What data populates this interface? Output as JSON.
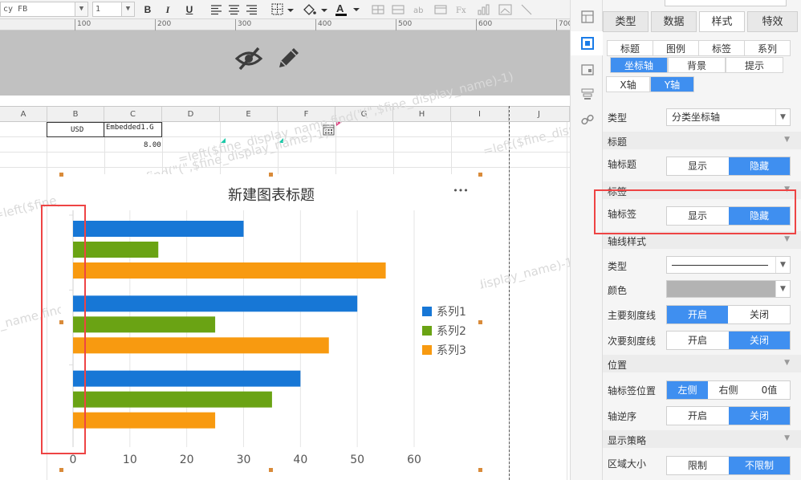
{
  "toolbar": {
    "font_name": "cy FB",
    "font_size": "1",
    "bold": "B",
    "italic": "I",
    "underline": "U"
  },
  "ruler": {
    "labels": [
      "100",
      "200",
      "300",
      "400",
      "500",
      "600",
      "700"
    ]
  },
  "columns": [
    "A",
    "B",
    "C",
    "D",
    "E",
    "F",
    "G",
    "H",
    "I",
    "J"
  ],
  "cells": {
    "b1": "USD",
    "c1": "Embedded1.G",
    "c2": "8.00"
  },
  "watermark": {
    "formula": "=left($fine_display_name,find(\"(\",$fine_display_name)-1)"
  },
  "chart_data": {
    "type": "bar",
    "orientation": "horizontal",
    "title": "新建图表标题",
    "menu": "•••",
    "categories": [
      "",
      "",
      ""
    ],
    "series": [
      {
        "name": "系列1",
        "color": "#1777d6",
        "values": [
          30,
          50,
          40
        ]
      },
      {
        "name": "系列2",
        "color": "#6aa314",
        "values": [
          15,
          25,
          35
        ]
      },
      {
        "name": "系列3",
        "color": "#f89a10",
        "values": [
          55,
          45,
          25
        ]
      }
    ],
    "xlim": [
      0,
      60
    ],
    "xticks": [
      "0",
      "10",
      "20",
      "30",
      "40",
      "50",
      "60"
    ],
    "grid": true,
    "legend": "right",
    "xlabel": "",
    "ylabel": ""
  },
  "panel": {
    "tabs": [
      "类型",
      "数据",
      "样式",
      "特效"
    ],
    "active_tab": 2,
    "subtabs_row1": [
      "标题",
      "图例",
      "标签",
      "系列"
    ],
    "subtabs_row2": [
      "坐标轴",
      "背景",
      "提示"
    ],
    "active_subtab": "坐标轴",
    "axis_tabs": [
      "X轴",
      "Y轴"
    ],
    "active_axis": "Y轴",
    "type_label": "类型",
    "type_value": "分类坐标轴",
    "section_title": "标题",
    "axis_title_label": "轴标题",
    "show": "显示",
    "hide": "隐藏",
    "section_label": "标签",
    "axis_label_label": "轴标签",
    "section_line": "轴线样式",
    "line_type_label": "类型",
    "color_label": "颜色",
    "color_value": "#b3b3b3",
    "major_tick_label": "主要刻度线",
    "minor_tick_label": "次要刻度线",
    "on": "开启",
    "off": "关闭",
    "section_position": "位置",
    "label_pos_label": "轴标签位置",
    "pos_left": "左侧",
    "pos_right": "右侧",
    "pos_zero": "0值",
    "reverse_label": "轴逆序",
    "section_display": "显示策略",
    "area_label": "区域大小",
    "limit": "限制",
    "no_limit": "不限制"
  },
  "colors": {
    "accent": "#3f8ff0",
    "highlight": "#e44444"
  }
}
